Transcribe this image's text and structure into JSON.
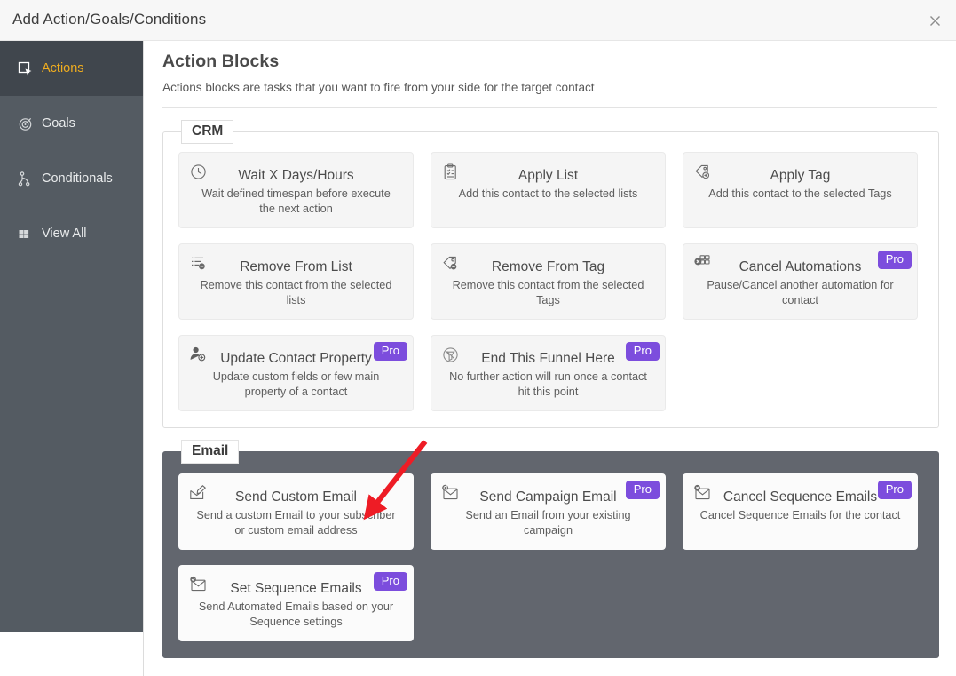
{
  "window": {
    "title": "Add Action/Goals/Conditions",
    "close_icon": "close-icon"
  },
  "sidebar": {
    "items": [
      {
        "label": "Actions",
        "icon": "action-block-icon",
        "active": true
      },
      {
        "label": "Goals",
        "icon": "target-icon",
        "active": false
      },
      {
        "label": "Conditionals",
        "icon": "branch-icon",
        "active": false
      },
      {
        "label": "View All",
        "icon": "grid-icon",
        "active": false
      }
    ]
  },
  "main": {
    "title": "Action Blocks",
    "subtitle": "Actions blocks are tasks that you want to fire from your side for the target contact",
    "groups": [
      {
        "legend": "CRM",
        "dark": false,
        "cards": [
          {
            "title": "Wait X Days/Hours",
            "desc": "Wait defined timespan before execute the next action",
            "icon": "clock-icon",
            "badge": ""
          },
          {
            "title": "Apply List",
            "desc": "Add this contact to the selected lists",
            "icon": "clipboard-list-icon",
            "badge": ""
          },
          {
            "title": "Apply Tag",
            "desc": "Add this contact to the selected Tags",
            "icon": "tag-add-icon",
            "badge": ""
          },
          {
            "title": "Remove From List",
            "desc": "Remove this contact from the selected lists",
            "icon": "list-remove-icon",
            "badge": ""
          },
          {
            "title": "Remove From Tag",
            "desc": "Remove this contact from the selected Tags",
            "icon": "tag-remove-icon",
            "badge": ""
          },
          {
            "title": "Cancel Automations",
            "desc": "Pause/Cancel another automation for contact",
            "icon": "automation-cancel-icon",
            "badge": "Pro"
          },
          {
            "title": "Update Contact Property",
            "desc": "Update custom fields or few main property of a contact",
            "icon": "user-edit-icon",
            "badge": "Pro"
          },
          {
            "title": "End This Funnel Here",
            "desc": "No further action will run once a contact hit this point",
            "icon": "stop-funnel-icon",
            "badge": "Pro"
          }
        ]
      },
      {
        "legend": "Email",
        "dark": true,
        "cards": [
          {
            "title": "Send Custom Email",
            "desc": "Send a custom Email to your subscriber or custom email address",
            "icon": "compose-email-icon",
            "badge": ""
          },
          {
            "title": "Send Campaign Email",
            "desc": "Send an Email from your existing campaign",
            "icon": "campaign-email-icon",
            "badge": "Pro"
          },
          {
            "title": "Cancel Sequence Emails",
            "desc": "Cancel Sequence Emails for the contact",
            "icon": "cancel-email-icon",
            "badge": "Pro"
          },
          {
            "title": "Set Sequence Emails",
            "desc": "Send Automated Emails based on your Sequence settings",
            "icon": "sequence-email-icon",
            "badge": "Pro"
          }
        ]
      }
    ]
  },
  "annotation": {
    "arrow_color": "#ee1c25",
    "target_card": "Send Custom Email"
  },
  "colors": {
    "sidebar_bg": "#545b62",
    "sidebar_active_bg": "#40464d",
    "sidebar_active_text": "#f0ad1f",
    "email_group_bg": "#62666e",
    "pro_badge": "#7c4ddd",
    "card_bg": "#f5f5f5"
  }
}
